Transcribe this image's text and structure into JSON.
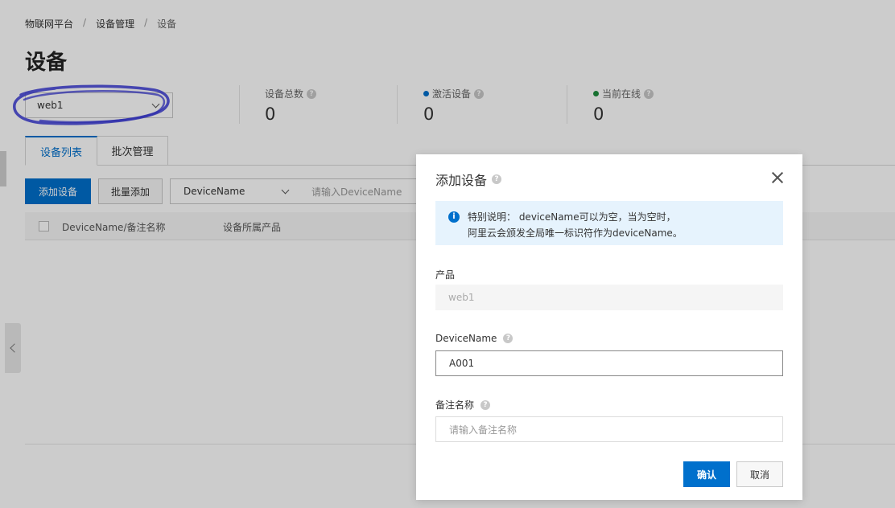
{
  "breadcrumb": [
    "物联网平台",
    "设备管理",
    "设备"
  ],
  "breadcrumb_separator": "/",
  "page_title": "设备",
  "product_select": {
    "value": "web1"
  },
  "stats": [
    {
      "label": "设备总数",
      "value": "0",
      "dot_color": null
    },
    {
      "label": "激活设备",
      "value": "0",
      "dot_color": "#0070cc"
    },
    {
      "label": "当前在线",
      "value": "0",
      "dot_color": "#1e8e3e"
    }
  ],
  "tabs": [
    {
      "label": "设备列表",
      "active": true
    },
    {
      "label": "批次管理",
      "active": false
    }
  ],
  "toolbar": {
    "add_device": "添加设备",
    "batch_add": "批量添加",
    "filter_field": "DeviceName",
    "search_placeholder": "请输入DeviceName"
  },
  "table": {
    "columns": [
      "DeviceName/备注名称",
      "设备所属产品"
    ]
  },
  "dialog": {
    "title": "添加设备",
    "notice_line1": "特别说明： deviceName可以为空，当为空时，",
    "notice_line2": "阿里云会颁发全局唯一标识符作为deviceName。",
    "product_label": "产品",
    "product_value": "web1",
    "device_name_label": "DeviceName",
    "device_name_value": "A001",
    "remark_label": "备注名称",
    "remark_placeholder": "请输入备注名称",
    "confirm": "确认",
    "cancel": "取消"
  },
  "colors": {
    "primary": "#0070cc",
    "annotation": "#3a3ad6",
    "notice_bg": "#e6f3fd",
    "online": "#1e8e3e"
  }
}
